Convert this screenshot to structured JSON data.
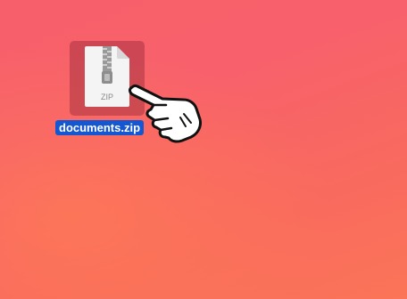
{
  "desktop": {
    "background_colors": [
      "#f7606a",
      "#fb7558"
    ],
    "icons": [
      {
        "icon": "zip-archive-icon",
        "badge_text": "ZIP",
        "label": "documents.zip",
        "selected": true
      }
    ]
  },
  "cursor": {
    "icon": "pointing-hand-cursor-icon"
  },
  "colors": {
    "selection_label_bg": "#1457d1",
    "selection_tile_bg": "#962837"
  }
}
